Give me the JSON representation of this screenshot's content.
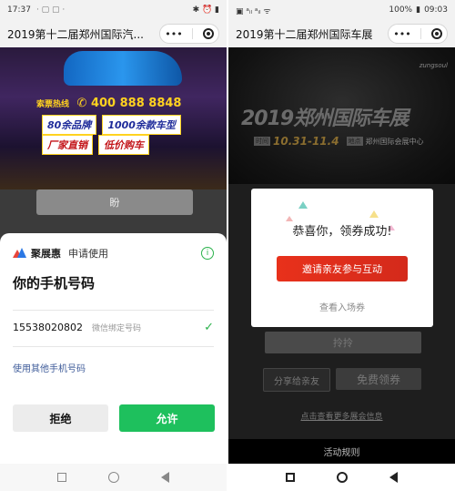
{
  "left": {
    "status": {
      "time": "17:37",
      "extra": "· ▢ ▢ ·",
      "icons": "✱ ⏰ ▮",
      "battery": "▮"
    },
    "window_title": "2019第十二届郑州国际汽...",
    "capsule": {
      "more": "•••"
    },
    "banner": {
      "hotline_label": "索票热线",
      "hotline_number": "400 888 8848",
      "promo1": "80余品牌",
      "promo2": "1000余款车型",
      "promo3": "厂家直销",
      "promo4": "低价购车"
    },
    "ghost_button": "盼",
    "sheet": {
      "app_name": "聚展惠",
      "action": "申请使用",
      "info": "i",
      "title": "你的手机号码",
      "phone_number": "15538020802",
      "phone_note": "微信绑定号码",
      "check": "✓",
      "other_phone": "使用其他手机号码",
      "deny": "拒绝",
      "allow": "允许"
    }
  },
  "right": {
    "status": {
      "left_icons": "▣ ᵃᵢₗ ᵃᵢₗ ᯤ",
      "battery": "100%",
      "time": "09:03"
    },
    "window_title": "2019第十二届郑州国际车展",
    "capsule": {
      "more": "•••"
    },
    "banner": {
      "brand": "zungsoul",
      "title": "2019郑州国际车展",
      "date_tag": "时间",
      "date": "10.31-11.4",
      "venue_tag": "地点",
      "venue": "郑州国际会展中心"
    },
    "dialog": {
      "title": "恭喜你，领券成功!",
      "invite": "邀请亲友参与互动",
      "view_ticket": "查看入场券"
    },
    "buttons": {
      "zanzan": "拎拎",
      "share": "分享给亲友",
      "free": "免费领券",
      "more": "点击查看更多展会信息",
      "rules": "活动规则"
    }
  },
  "colors": {
    "wechat_green": "#1ec05d",
    "invite_red": "#e8311b",
    "link_blue": "#3e5b99"
  }
}
